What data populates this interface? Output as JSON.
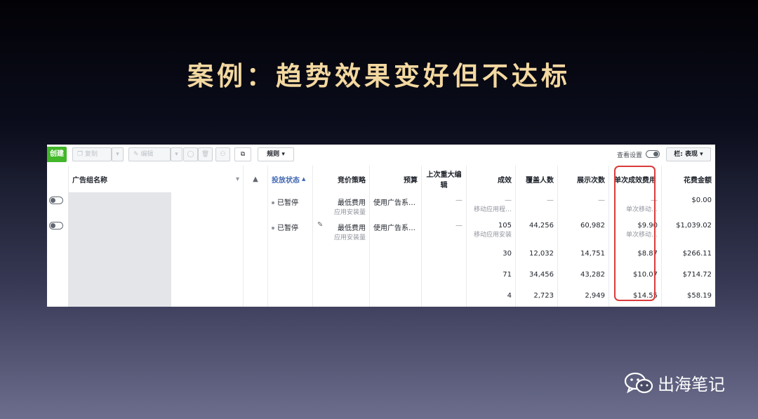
{
  "slide": {
    "title": "案例：趋势效果变好但不达标"
  },
  "toolbar": {
    "create_label": "创建",
    "copy_label": "复制",
    "edit_label": "编辑",
    "rules_label": "规则",
    "view_settings_label": "查看设置",
    "columns_label": "栏: 表现"
  },
  "table": {
    "headers": {
      "name": "广告组名称",
      "delivery": "投放状态",
      "bid_strategy": "竞价策略",
      "budget": "预算",
      "last_edit": "上次重大编辑",
      "results": "成效",
      "reach": "覆盖人数",
      "impressions": "展示次数",
      "cost_per_result": "单次成效费用",
      "amount_spent": "花费金额"
    },
    "rows": [
      {
        "delivery": "已暂停",
        "bid_main": "最低费用",
        "bid_sub": "应用安装量",
        "budget": "使用广告系…",
        "last_edit": "—",
        "results_main": "—",
        "results_sub": "移动应用程…",
        "reach": "—",
        "impressions": "—",
        "cpr_main": "—",
        "cpr_sub": "单次移动…",
        "spent": "$0.00"
      },
      {
        "delivery": "已暂停",
        "bid_main": "最低费用",
        "bid_sub": "应用安装量",
        "budget": "使用广告系…",
        "last_edit": "—",
        "results_main": "105",
        "results_sub": "移动应用安装",
        "reach": "44,256",
        "impressions": "60,982",
        "cpr_main": "$9.90",
        "cpr_sub": "单次移动…",
        "spent": "$1,039.02"
      },
      {
        "results_main": "30",
        "reach": "12,032",
        "impressions": "14,751",
        "cpr_main": "$8.87",
        "spent": "$266.11"
      },
      {
        "results_main": "71",
        "reach": "34,456",
        "impressions": "43,282",
        "cpr_main": "$10.07",
        "spent": "$714.72"
      },
      {
        "results_main": "4",
        "reach": "2,723",
        "impressions": "2,949",
        "cpr_main": "$14.55",
        "spent": "$58.19"
      }
    ]
  },
  "watermark": {
    "text": "出海笔记"
  },
  "colors": {
    "title": "#f3d8a0",
    "create_button": "#42b72a",
    "highlight": "#d93b3b",
    "link_blue": "#4267b2"
  }
}
